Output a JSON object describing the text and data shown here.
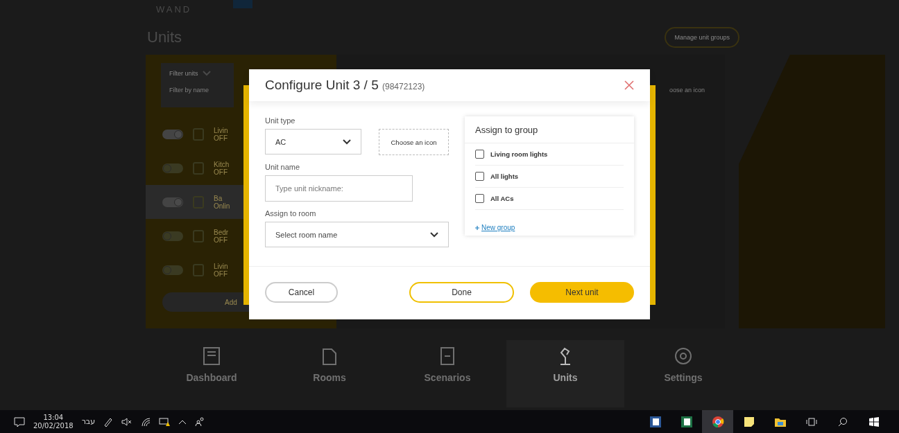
{
  "header": {
    "logo": "WAND",
    "title": "Units",
    "manage_button": "Manage unit groups"
  },
  "filter": {
    "label": "Filter units",
    "placeholder": "Filter by name"
  },
  "units": [
    {
      "name": "Livin",
      "status": "OFF",
      "on": true,
      "highlighted": false
    },
    {
      "name": "Kitch",
      "status": "OFF",
      "on": false,
      "highlighted": false
    },
    {
      "name": "Ba",
      "status": "Onlin",
      "on": true,
      "highlighted": true
    },
    {
      "name": "Bedr",
      "status": "OFF",
      "on": false,
      "highlighted": false
    },
    {
      "name": "Livin",
      "status": "OFF",
      "on": false,
      "highlighted": false
    }
  ],
  "add_button": "Add",
  "detail_hint": "oose an icon",
  "dialog": {
    "title": "Configure Unit 3 / 5",
    "serial": "(98472123)",
    "unit_type": {
      "label": "Unit type",
      "value": "AC"
    },
    "icon_button": "Choose an icon",
    "unit_name": {
      "label": "Unit name",
      "placeholder": "Type unit nickname:"
    },
    "room": {
      "label": "Assign to room",
      "value": "Select room name"
    },
    "groups": {
      "title": "Assign to group",
      "items": [
        {
          "label": "Living room lights",
          "checked": false
        },
        {
          "label": "All lights",
          "checked": false
        },
        {
          "label": "All ACs",
          "checked": false
        }
      ],
      "new_group": "New group"
    },
    "buttons": {
      "cancel": "Cancel",
      "done": "Done",
      "next": "Next unit"
    }
  },
  "nav": [
    {
      "label": "Dashboard",
      "selected": false
    },
    {
      "label": "Rooms",
      "selected": false
    },
    {
      "label": "Scenarios",
      "selected": false
    },
    {
      "label": "Units",
      "selected": true
    },
    {
      "label": "Settings",
      "selected": false
    }
  ],
  "taskbar": {
    "time": "13:04",
    "date": "20/02/2018",
    "language": "עבר",
    "apps": [
      {
        "kind": "word",
        "selected": false
      },
      {
        "kind": "excel",
        "selected": false
      },
      {
        "kind": "chrome",
        "selected": true
      },
      {
        "kind": "notes",
        "selected": false
      },
      {
        "kind": "folder",
        "selected": false
      }
    ]
  }
}
